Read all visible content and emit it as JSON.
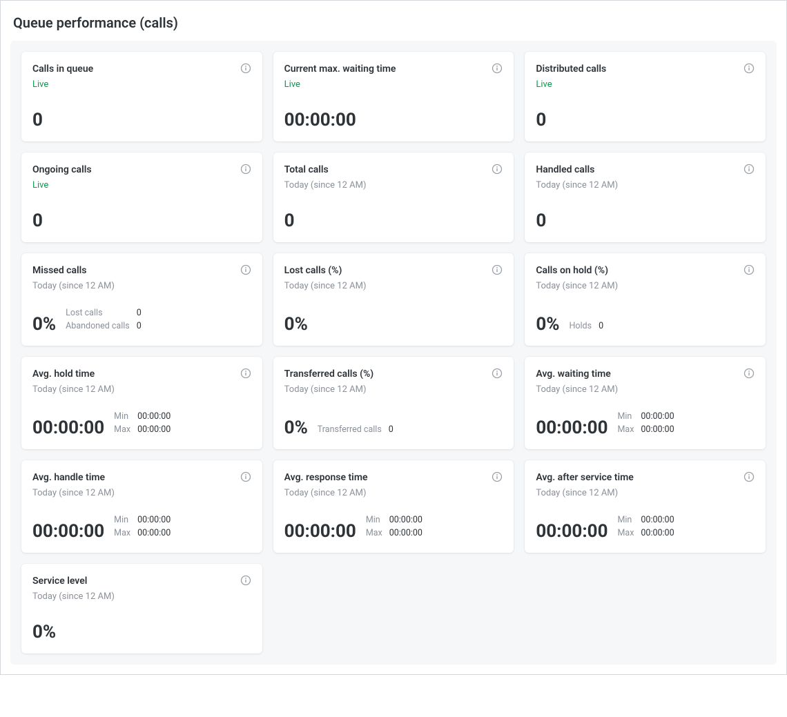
{
  "page_title": "Queue performance (calls)",
  "subtitles": {
    "live": "Live",
    "today": "Today (since 12 AM)"
  },
  "labels": {
    "min": "Min",
    "max": "Max",
    "lost_calls": "Lost calls",
    "abandoned_calls": "Abandoned calls",
    "holds": "Holds",
    "transferred_calls": "Transferred calls"
  },
  "cards": {
    "calls_in_queue": {
      "title": "Calls in queue",
      "value": "0"
    },
    "current_max_waiting": {
      "title": "Current max. waiting time",
      "value": "00:00:00"
    },
    "distributed_calls": {
      "title": "Distributed calls",
      "value": "0"
    },
    "ongoing_calls": {
      "title": "Ongoing calls",
      "value": "0"
    },
    "total_calls": {
      "title": "Total calls",
      "value": "0"
    },
    "handled_calls": {
      "title": "Handled calls",
      "value": "0"
    },
    "missed_calls": {
      "title": "Missed calls",
      "value": "0%",
      "lost": "0",
      "abandoned": "0"
    },
    "lost_calls_pct": {
      "title": "Lost calls (%)",
      "value": "0%"
    },
    "calls_on_hold_pct": {
      "title": "Calls on hold (%)",
      "value": "0%",
      "holds": "0"
    },
    "avg_hold_time": {
      "title": "Avg. hold time",
      "value": "00:00:00",
      "min": "00:00:00",
      "max": "00:00:00"
    },
    "transferred_calls_pct": {
      "title": "Transferred calls (%)",
      "value": "0%",
      "transferred": "0"
    },
    "avg_waiting_time": {
      "title": "Avg. waiting time",
      "value": "00:00:00",
      "min": "00:00:00",
      "max": "00:00:00"
    },
    "avg_handle_time": {
      "title": "Avg. handle time",
      "value": "00:00:00",
      "min": "00:00:00",
      "max": "00:00:00"
    },
    "avg_response_time": {
      "title": "Avg. response time",
      "value": "00:00:00",
      "min": "00:00:00",
      "max": "00:00:00"
    },
    "avg_after_service_time": {
      "title": "Avg. after service time",
      "value": "00:00:00",
      "min": "00:00:00",
      "max": "00:00:00"
    },
    "service_level": {
      "title": "Service level",
      "value": "0%"
    }
  }
}
